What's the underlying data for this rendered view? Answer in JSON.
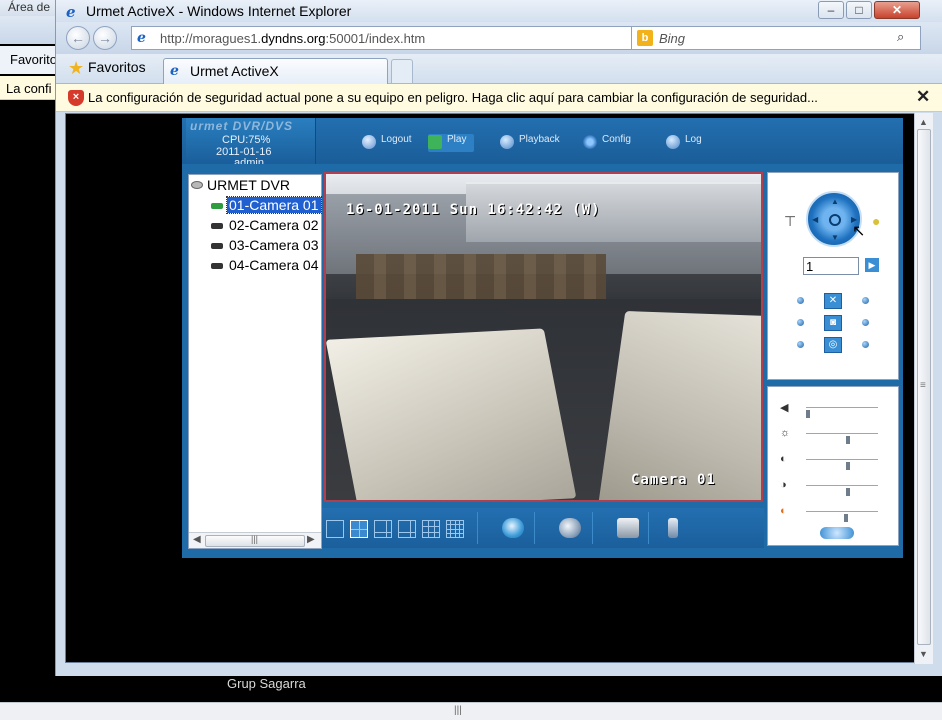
{
  "background_window": {
    "title": "Área de",
    "favorites_label": "Favorito",
    "info_text": "La confi"
  },
  "window": {
    "title": "Urmet ActiveX - Windows Internet Explorer",
    "minimize": "–",
    "maximize": "□",
    "close": "✕"
  },
  "nav": {
    "back": "←",
    "forward": "→",
    "address_prefix": "http://moragues1.",
    "address_host": "dyndns.org",
    "address_suffix": ":50001/index.htm",
    "dropdown": "▼",
    "refresh": "⇆",
    "stop": "✕",
    "search_placeholder": "Bing",
    "search_logo": "b",
    "search_icon": "⌕"
  },
  "tabs": {
    "favorites_label": "Favoritos",
    "active_tab_label": "Urmet ActiveX"
  },
  "info_bar": {
    "text": "La configuración de seguridad actual pone a su equipo en peligro. Haga clic aquí para cambiar la configuración de seguridad...",
    "close": "✕"
  },
  "dvr": {
    "brand": "urmet DVR/DVS",
    "cpu": "CPU:75%",
    "date": "2011-01-16",
    "user": "admin",
    "menu": [
      {
        "label": "Logout"
      },
      {
        "label": "Play"
      },
      {
        "label": "Playback"
      },
      {
        "label": "Config"
      },
      {
        "label": "Log"
      }
    ],
    "tree": {
      "root": "URMET DVR",
      "cameras": [
        "01-Camera 01",
        "02-Camera 02",
        "03-Camera 03",
        "04-Camera 04"
      ],
      "selected_index": 0
    },
    "video": {
      "osd_timestamp": "16-01-2011 Sun 16:42:42 (W)",
      "osd_camera": "Camera 01"
    },
    "ptz": {
      "preset_value": "1"
    }
  },
  "status": {
    "text": "Grup Sagarra"
  },
  "icons": {
    "ie": "internet-explorer-icon",
    "shield": "security-shield-icon",
    "star": "favorites-star-icon"
  },
  "colors": {
    "dvr_blue": "#1f6ba8",
    "info_bar": "#fffbe1",
    "selection": "#1f5fd0",
    "video_border": "#b04050"
  }
}
